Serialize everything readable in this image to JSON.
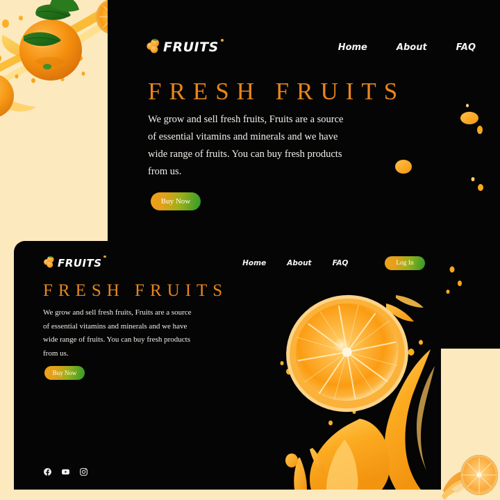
{
  "page": {
    "background_color": "#fce9be",
    "card_color": "#050505",
    "accent_orange": "#e8861d",
    "accent_green": "#2e9b2e",
    "text_color": "#f3f0ea"
  },
  "card_top": {
    "brand": {
      "name": "FRUITS",
      "mark_icon": "oranges-cluster-icon",
      "dot_icon": "orange-dot-icon"
    },
    "nav": [
      {
        "label": "Home"
      },
      {
        "label": "About"
      },
      {
        "label": "FAQ"
      }
    ],
    "headline": "FRESH FRUITS",
    "paragraph_lines": [
      "We grow and sell fresh fruits, Fruits are a source",
      "of essential vitamins and minerals and we have",
      "wide range of fruits. You can buy fresh products",
      "from us."
    ],
    "cta": {
      "label": "Buy Now"
    }
  },
  "card_bottom": {
    "brand": {
      "name": "FRUITS",
      "mark_icon": "oranges-cluster-icon",
      "dot_icon": "orange-dot-icon"
    },
    "nav": [
      {
        "label": "Home"
      },
      {
        "label": "About"
      },
      {
        "label": "FAQ"
      }
    ],
    "login": {
      "label": "Log In"
    },
    "headline": "FRESH FRUITS",
    "paragraph_lines": [
      "We grow and sell fresh fruits, Fruits are a source",
      "of essential vitamins and minerals and we have",
      "wide range of fruits. You can buy fresh products",
      "from us."
    ],
    "cta": {
      "label": "Buy Now"
    },
    "social": [
      {
        "name": "facebook-icon"
      },
      {
        "name": "youtube-icon"
      },
      {
        "name": "instagram-icon"
      }
    ]
  },
  "artwork": {
    "top_left": "oranges-with-leaves-and-juice-splash",
    "top_right_card": "juice-droplets-and-splash",
    "bottom_center": "orange-slice-with-juice-splash",
    "bottom_right": "sliced-orange-on-cream"
  }
}
